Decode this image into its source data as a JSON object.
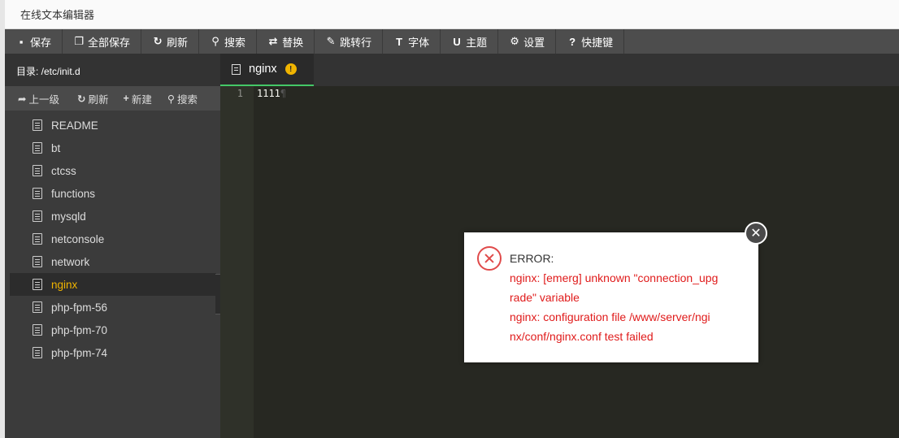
{
  "app": {
    "title": "在线文本编辑器"
  },
  "toolbar": {
    "save": "保存",
    "save_all": "全部保存",
    "refresh": "刷新",
    "search": "搜索",
    "replace": "替换",
    "goto_line": "跳转行",
    "font": "字体",
    "theme": "主题",
    "settings": "设置",
    "shortcuts": "快捷键"
  },
  "sidebar": {
    "dir_label": "目录: /etc/init.d",
    "actions": {
      "up": "上一级",
      "refresh": "刷新",
      "new": "新建",
      "search": "搜索"
    },
    "files": [
      "README",
      "bt",
      "ctcss",
      "functions",
      "mysqld",
      "netconsole",
      "network",
      "nginx",
      "php-fpm-56",
      "php-fpm-70",
      "php-fpm-74"
    ]
  },
  "editor": {
    "tab_name": "nginx",
    "line_number": "1",
    "content": "1111",
    "eol_mark": "¶"
  },
  "dialog": {
    "title": "ERROR:",
    "lines": [
      "nginx: [emerg] unknown \"connection_upg",
      "rade\" variable",
      "nginx: configuration file /www/server/ngi",
      "nx/conf/nginx.conf test failed"
    ]
  },
  "colors": {
    "accent": "#44c767",
    "active_file": "#f0b400",
    "error": "#e01b1b"
  }
}
